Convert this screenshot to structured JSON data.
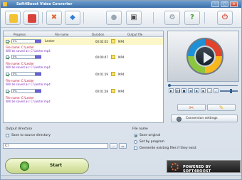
{
  "window": {
    "title": "Soft4Boost Video Converter"
  },
  "toolbar": {
    "buttons": [
      {
        "icon": "add-folder-icon",
        "color": "#f1c232",
        "glyph": ""
      },
      {
        "icon": "remove-file-icon",
        "color": "#d9413a",
        "glyph": ""
      },
      {
        "icon": "clear-list-icon",
        "color": "#e0662b",
        "glyph": "✖"
      },
      {
        "icon": "move-up-icon",
        "color": "#2f7fd4",
        "glyph": "◆"
      },
      {
        "icon": "lightbulb-icon",
        "color": "#9aa7b4",
        "glyph": "●"
      },
      {
        "icon": "video-icon",
        "color": "#4a4a4a",
        "glyph": "▣"
      },
      {
        "icon": "settings-icon",
        "color": "#7f8c99",
        "glyph": "⚙"
      },
      {
        "icon": "help-icon",
        "color": "#4f9a3a",
        "glyph": "?"
      },
      {
        "icon": "update-icon",
        "color": "#d94437",
        "glyph": "⏻"
      }
    ]
  },
  "file_list": {
    "headers": [
      "Progress",
      "File name",
      "Duration",
      "Output file"
    ],
    "rows": [
      {
        "progress": "0%",
        "progress_fraction": 0,
        "name": "Lester",
        "duration": "00:02:02",
        "output": "MP4",
        "src": "File name: C:\\Lester",
        "dst": "Will be saved as: C:\\Lester.mp4"
      },
      {
        "progress": "0%",
        "progress_fraction": 0,
        "name": "",
        "duration": "00:00:47",
        "output": "MP4",
        "src": "File name: C:\\Lester",
        "dst": "Will be saved as: C:\\Lester.mp4"
      },
      {
        "progress": "0%",
        "progress_fraction": 0,
        "name": "",
        "duration": "00:01:19",
        "output": "MP4",
        "src": "File name: C:\\Lester",
        "dst": "Will be saved as: C:\\Lester.mp4"
      },
      {
        "progress": "0%",
        "progress_fraction": 0,
        "name": "",
        "duration": "00:01:28",
        "output": "MP4",
        "src": "File name: C:\\Lester",
        "dst": "Will be saved as: C:\\Lester.mp4"
      }
    ]
  },
  "player": {
    "seek_fraction": 0.0,
    "volume_fraction": 0.65
  },
  "actions": {
    "conversion_settings": "Conversion settings"
  },
  "output_directory": {
    "title": "Output directory",
    "same_as_source": "Save to source directory",
    "path": "C:\\",
    "browse": "...",
    "open": "▭"
  },
  "after_conversion": {
    "title": "File name",
    "options": [
      {
        "label": "Save original",
        "selected": true
      },
      {
        "label": "Set by program",
        "selected": false
      }
    ],
    "overwrite": "Overwrite existing files if they exist"
  },
  "start": {
    "label": "Start"
  },
  "branding": {
    "label": "POWERED BY SOFT4BOOST"
  }
}
